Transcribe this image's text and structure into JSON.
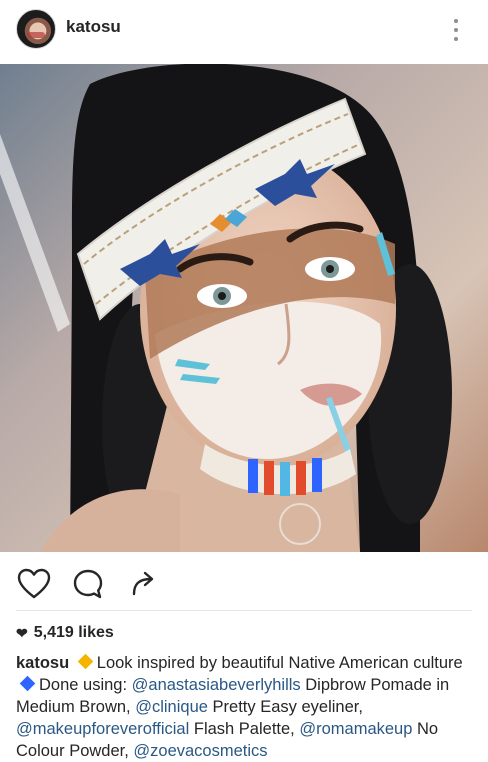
{
  "header": {
    "username": "katosu"
  },
  "likes": {
    "count_text": "5,419 likes"
  },
  "caption": {
    "username": "katosu",
    "part1": "Look inspired by beautiful Native American culture",
    "part2": "Done using:",
    "mention1": "@anastasiabeverlyhills",
    "part3": "Dipbrow Pomade in Medium Brown,",
    "mention2": "@clinique",
    "part4": "Pretty Easy eyeliner,",
    "mention3": "@makeupforeverofficial",
    "part5": "Flash Palette,",
    "mention4": "@romamakeup",
    "part6": "No Colour Powder,",
    "mention5": "@zoevacosmetics"
  },
  "colors": {
    "link": "#2a5885",
    "diamond_yellow": "#f4b400",
    "diamond_blue": "#2e64ff"
  }
}
